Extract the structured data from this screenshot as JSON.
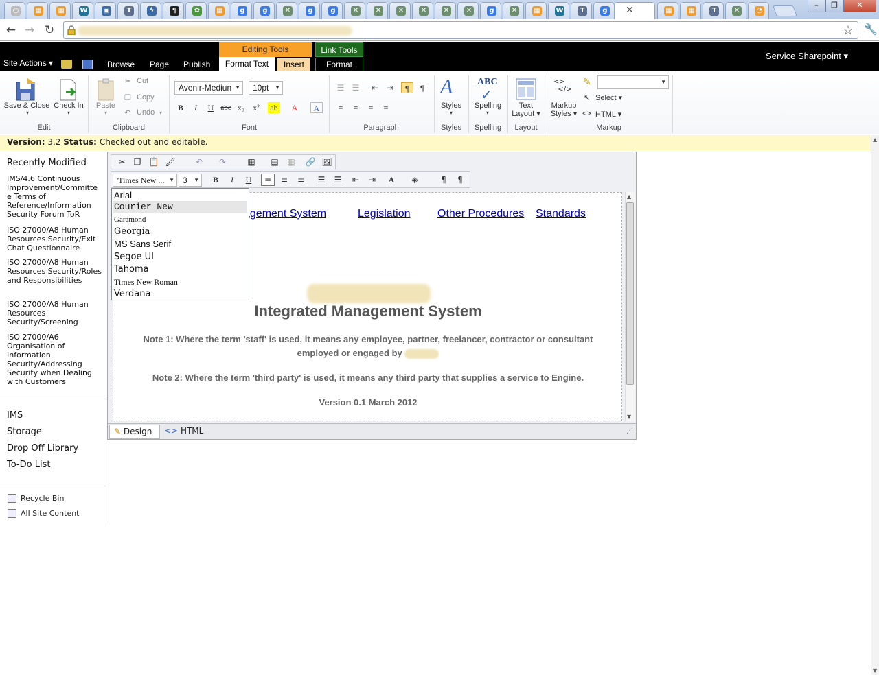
{
  "browser": {
    "tab_icons": [
      "generic-icon",
      "feed-icon",
      "feed-icon",
      "wordpress-icon",
      "image-icon",
      "tn-icon",
      "lightning-icon",
      "paragraph-icon",
      "leaf-icon",
      "feed-icon",
      "google-icon",
      "google-icon",
      "x-icon",
      "google-icon",
      "google-icon",
      "x-icon",
      "x-icon",
      "x-icon",
      "x-icon",
      "x-icon",
      "x-icon",
      "google-icon",
      "x-icon",
      "feed-icon",
      "wordpress-icon",
      "tn-icon",
      "google-icon"
    ],
    "active_tab_close": "✕",
    "after_tabs_icons": [
      "feed-icon",
      "feed-icon",
      "tn-icon",
      "x-icon",
      "rss-icon"
    ],
    "window_buttons": {
      "minimize": "–",
      "restore": "❐",
      "close": "✕"
    },
    "nav": {
      "back": "←",
      "forward": "→",
      "reload": "↻",
      "star": "☆",
      "wrench": "🔧"
    }
  },
  "sharepoint": {
    "site_actions": "Site Actions",
    "tabs": [
      "Browse",
      "Page",
      "Publish",
      "Format Text",
      "Insert",
      "Format"
    ],
    "editing_tools": "Editing Tools",
    "link_tools": "Link Tools",
    "user": "Service Sharepoint",
    "ribbon": {
      "edit": {
        "save_close": "Save & Close",
        "check_in": "Check In",
        "label": "Edit"
      },
      "clipboard": {
        "paste": "Paste",
        "cut": "Cut",
        "copy": "Copy",
        "undo": "Undo",
        "label": "Clipboard"
      },
      "font": {
        "family": "Avenir-Mediun",
        "size": "10pt",
        "label": "Font"
      },
      "paragraph": {
        "label": "Paragraph"
      },
      "styles": {
        "styles": "Styles",
        "label": "Styles"
      },
      "spelling": {
        "spelling": "Spelling",
        "label": "Spelling"
      },
      "layout": {
        "text": "Text",
        "layout_word": "Layout",
        "label": "Layout"
      },
      "markup": {
        "markup": "Markup",
        "styles": "Styles",
        "select": "Select",
        "html": "HTML",
        "label": "Markup"
      }
    },
    "status": {
      "version_label": "Version:",
      "version": "3.2",
      "status_label": "Status:",
      "status": "Checked out and editable."
    }
  },
  "leftnav": {
    "recently_modified": "Recently Modified",
    "recent_items": [
      "IMS/4.6 Continuous Improvement/Committe e Terms of Reference/Information Security Forum ToR",
      "ISO 27000/A8 Human Resources Security/Exit Chat Questionnaire",
      "ISO 27000/A8 Human Resources Security/Roles and Responsibilities",
      "ISO 27000/A8 Human Resources Security/Screening",
      "ISO 27000/A6 Organisation of Information Security/Addressing Security when Dealing with Customers"
    ],
    "libraries": [
      "IMS",
      "Storage",
      "Drop Off Library",
      "To-Do List"
    ],
    "recycle_bin": "Recycle Bin",
    "all_site_content": "All Site Content"
  },
  "editor": {
    "font_select": "'Times New ...",
    "size_select": "3",
    "links": [
      "agement System",
      "Legislation",
      "Other Procedures",
      "Standards"
    ],
    "heading": "Integrated Management System",
    "note1_line1": "Note 1: Where the term 'staff' is used, it  means any employee, partner, freelancer, contractor or consultant",
    "note1_line2": "employed or engaged by",
    "note2": "Note 2: Where the term 'third party' is used, it means any third party that supplies a service to Engine.",
    "version": "Version 0.1 March 2012",
    "design_tab": "Design",
    "html_tab": "HTML",
    "font_options": [
      "Arial",
      "Courier New",
      "Garamond",
      "Georgia",
      "MS Sans Serif",
      "Segoe UI",
      "Tahoma",
      "Times New Roman",
      "Verdana"
    ],
    "selected_font": "Courier New"
  },
  "colors": {
    "ribbon_accent": "#f7a128",
    "status_bg": "#fff9c7",
    "link": "#0000cc",
    "link_tools": "#1e6a1e"
  }
}
